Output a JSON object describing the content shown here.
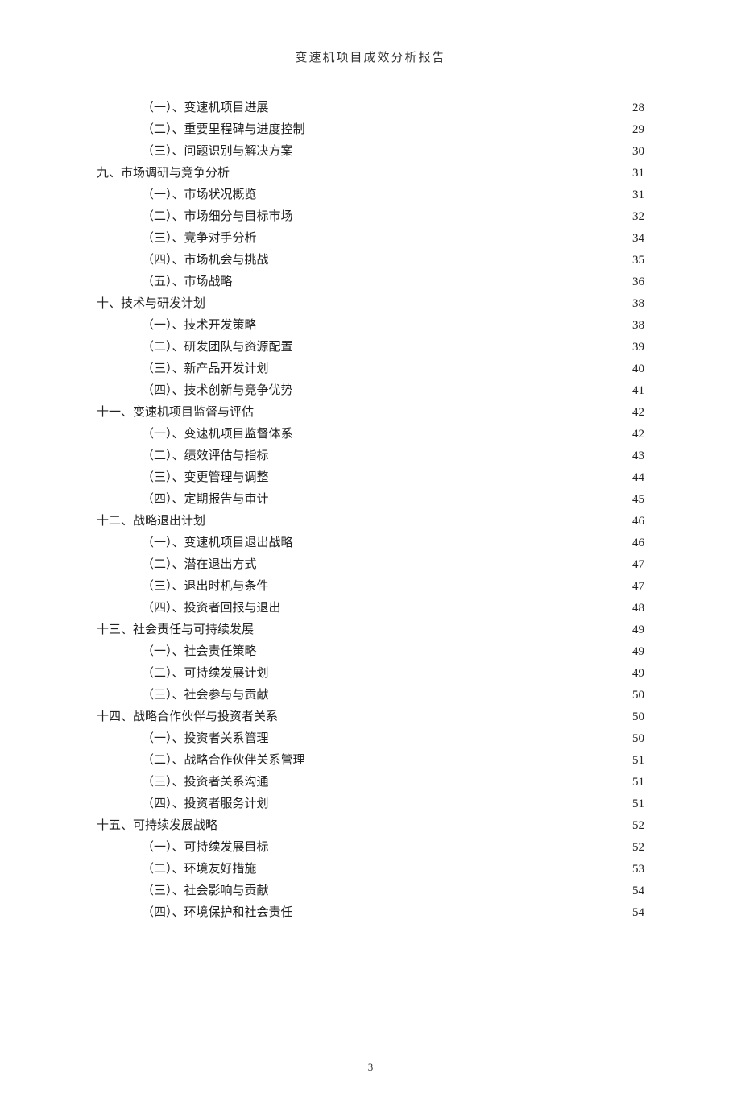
{
  "header": {
    "title": "变速机项目成效分析报告"
  },
  "toc": [
    {
      "level": 2,
      "label": "（一）、变速机项目进展",
      "page": "28"
    },
    {
      "level": 2,
      "label": "（二）、重要里程碑与进度控制",
      "page": "29"
    },
    {
      "level": 2,
      "label": "（三）、问题识别与解决方案",
      "page": "30"
    },
    {
      "level": 1,
      "label": "九、市场调研与竞争分析",
      "page": "31"
    },
    {
      "level": 2,
      "label": "（一）、市场状况概览",
      "page": "31"
    },
    {
      "level": 2,
      "label": "（二）、市场细分与目标市场",
      "page": "32"
    },
    {
      "level": 2,
      "label": "（三）、竞争对手分析",
      "page": "34"
    },
    {
      "level": 2,
      "label": "（四）、市场机会与挑战",
      "page": "35"
    },
    {
      "level": 2,
      "label": "（五）、市场战略",
      "page": "36"
    },
    {
      "level": 1,
      "label": "十、技术与研发计划",
      "page": "38"
    },
    {
      "level": 2,
      "label": "（一）、技术开发策略",
      "page": "38"
    },
    {
      "level": 2,
      "label": "（二）、研发团队与资源配置",
      "page": "39"
    },
    {
      "level": 2,
      "label": "（三）、新产品开发计划",
      "page": "40"
    },
    {
      "level": 2,
      "label": "（四）、技术创新与竞争优势",
      "page": "41"
    },
    {
      "level": 1,
      "label": "十一、变速机项目监督与评估",
      "page": "42"
    },
    {
      "level": 2,
      "label": "（一）、变速机项目监督体系",
      "page": "42"
    },
    {
      "level": 2,
      "label": "（二）、绩效评估与指标",
      "page": "43"
    },
    {
      "level": 2,
      "label": "（三）、变更管理与调整",
      "page": "44"
    },
    {
      "level": 2,
      "label": "（四）、定期报告与审计",
      "page": "45"
    },
    {
      "level": 1,
      "label": "十二、战略退出计划",
      "page": "46"
    },
    {
      "level": 2,
      "label": "（一）、变速机项目退出战略",
      "page": "46"
    },
    {
      "level": 2,
      "label": "（二）、潜在退出方式",
      "page": "47"
    },
    {
      "level": 2,
      "label": "（三）、退出时机与条件",
      "page": "47"
    },
    {
      "level": 2,
      "label": "（四）、投资者回报与退出",
      "page": "48"
    },
    {
      "level": 1,
      "label": "十三、社会责任与可持续发展",
      "page": "49"
    },
    {
      "level": 2,
      "label": "（一）、社会责任策略",
      "page": "49"
    },
    {
      "level": 2,
      "label": "（二）、可持续发展计划",
      "page": "49"
    },
    {
      "level": 2,
      "label": "（三）、社会参与与贡献",
      "page": "50"
    },
    {
      "level": 1,
      "label": "十四、战略合作伙伴与投资者关系",
      "page": "50"
    },
    {
      "level": 2,
      "label": "（一）、投资者关系管理",
      "page": "50"
    },
    {
      "level": 2,
      "label": "（二）、战略合作伙伴关系管理",
      "page": "51"
    },
    {
      "level": 2,
      "label": "（三）、投资者关系沟通",
      "page": "51"
    },
    {
      "level": 2,
      "label": "（四）、投资者服务计划",
      "page": "51"
    },
    {
      "level": 1,
      "label": "十五、可持续发展战略",
      "page": "52"
    },
    {
      "level": 2,
      "label": "（一）、可持续发展目标",
      "page": "52"
    },
    {
      "level": 2,
      "label": "（二）、环境友好措施",
      "page": "53"
    },
    {
      "level": 2,
      "label": "（三）、社会影响与贡献",
      "page": "54"
    },
    {
      "level": 2,
      "label": "（四）、环境保护和社会责任",
      "page": "54"
    }
  ],
  "footer": {
    "pageNumber": "3"
  }
}
